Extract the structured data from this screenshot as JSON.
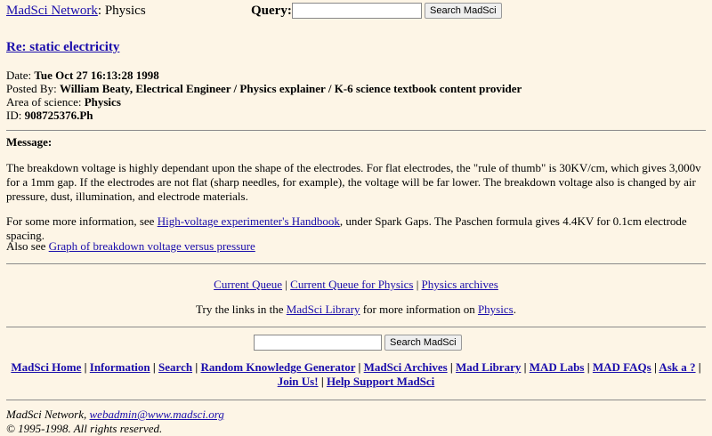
{
  "header": {
    "site_link": "MadSci Network",
    "site_sep": ": Physics",
    "query_label": "Query:",
    "search_button": "Search MadSci",
    "query_value": ""
  },
  "post": {
    "title": "Re: static electricity",
    "date_label": "Date: ",
    "date_value": "Tue Oct 27 16:13:28 1998",
    "posted_label": "Posted By: ",
    "posted_value": "William Beaty, Electrical Engineer / Physics explainer / K-6 science textbook content provider",
    "area_label": "Area of science: ",
    "area_value": "Physics",
    "id_label": "ID: ",
    "id_value": "908725376.Ph",
    "message_label": "Message:",
    "para1": "The breakdown voltage is highly dependant upon the shape of the electrodes. For flat electrodes, the \"rule of thumb\" is 30KV/cm, which gives 3,000v for a 1mm gap. If the electrodes are not flat (sharp needles, for example), the voltage will be far lower. The breakdown voltage also is changed by air pressure, dust, illumination, and electrode materials.",
    "para2_pre": "For some more information, see ",
    "para2_link": "High-voltage experimenter's Handbook",
    "para2_post": ", under Spark Gaps. The Paschen formula gives 4.4KV for 0.1cm electrode spacing.",
    "para3_pre": "Also see ",
    "para3_link": "Graph of breakdown voltage versus pressure"
  },
  "queue_links": {
    "current_queue": "Current Queue",
    "current_queue_physics": "Current Queue for Physics",
    "physics_archives": "Physics archives",
    "sep": " | "
  },
  "library_line": {
    "pre": "Try the links in the ",
    "library_link": "MadSci Library",
    "mid": " for more information on ",
    "physics_link": "Physics",
    "post": "."
  },
  "bottom_search": {
    "button": "Search MadSci",
    "value": ""
  },
  "footer_links": [
    "MadSci Home",
    "Information",
    "Search",
    "Random Knowledge Generator",
    "MadSci Archives",
    "Mad Library",
    "MAD Labs",
    "MAD FAQs",
    "Ask a ?",
    "Join Us!",
    "Help Support MadSci"
  ],
  "footer_sep": " | ",
  "address": {
    "network": "MadSci Network, ",
    "email": "webadmin@www.madsci.org",
    "copyright": "© 1995-1998. All rights reserved."
  },
  "colors": {
    "background": "#fdf5e6",
    "link": "#1a0dab",
    "rule": "#8a8a8a"
  }
}
